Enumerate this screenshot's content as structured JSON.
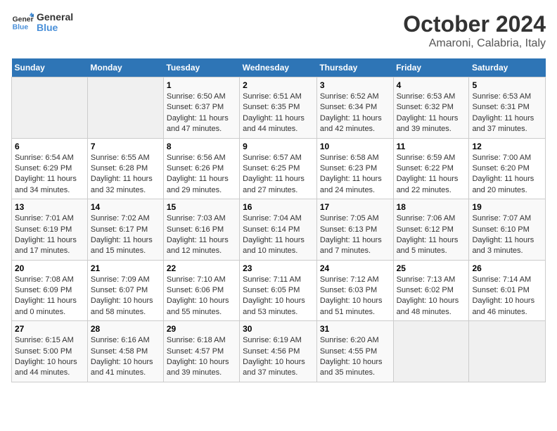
{
  "logo": {
    "text_general": "General",
    "text_blue": "Blue"
  },
  "title": "October 2024",
  "subtitle": "Amaroni, Calabria, Italy",
  "header_days": [
    "Sunday",
    "Monday",
    "Tuesday",
    "Wednesday",
    "Thursday",
    "Friday",
    "Saturday"
  ],
  "weeks": [
    [
      {
        "day": "",
        "info": ""
      },
      {
        "day": "",
        "info": ""
      },
      {
        "day": "1",
        "info": "Sunrise: 6:50 AM\nSunset: 6:37 PM\nDaylight: 11 hours and 47 minutes."
      },
      {
        "day": "2",
        "info": "Sunrise: 6:51 AM\nSunset: 6:35 PM\nDaylight: 11 hours and 44 minutes."
      },
      {
        "day": "3",
        "info": "Sunrise: 6:52 AM\nSunset: 6:34 PM\nDaylight: 11 hours and 42 minutes."
      },
      {
        "day": "4",
        "info": "Sunrise: 6:53 AM\nSunset: 6:32 PM\nDaylight: 11 hours and 39 minutes."
      },
      {
        "day": "5",
        "info": "Sunrise: 6:53 AM\nSunset: 6:31 PM\nDaylight: 11 hours and 37 minutes."
      }
    ],
    [
      {
        "day": "6",
        "info": "Sunrise: 6:54 AM\nSunset: 6:29 PM\nDaylight: 11 hours and 34 minutes."
      },
      {
        "day": "7",
        "info": "Sunrise: 6:55 AM\nSunset: 6:28 PM\nDaylight: 11 hours and 32 minutes."
      },
      {
        "day": "8",
        "info": "Sunrise: 6:56 AM\nSunset: 6:26 PM\nDaylight: 11 hours and 29 minutes."
      },
      {
        "day": "9",
        "info": "Sunrise: 6:57 AM\nSunset: 6:25 PM\nDaylight: 11 hours and 27 minutes."
      },
      {
        "day": "10",
        "info": "Sunrise: 6:58 AM\nSunset: 6:23 PM\nDaylight: 11 hours and 24 minutes."
      },
      {
        "day": "11",
        "info": "Sunrise: 6:59 AM\nSunset: 6:22 PM\nDaylight: 11 hours and 22 minutes."
      },
      {
        "day": "12",
        "info": "Sunrise: 7:00 AM\nSunset: 6:20 PM\nDaylight: 11 hours and 20 minutes."
      }
    ],
    [
      {
        "day": "13",
        "info": "Sunrise: 7:01 AM\nSunset: 6:19 PM\nDaylight: 11 hours and 17 minutes."
      },
      {
        "day": "14",
        "info": "Sunrise: 7:02 AM\nSunset: 6:17 PM\nDaylight: 11 hours and 15 minutes."
      },
      {
        "day": "15",
        "info": "Sunrise: 7:03 AM\nSunset: 6:16 PM\nDaylight: 11 hours and 12 minutes."
      },
      {
        "day": "16",
        "info": "Sunrise: 7:04 AM\nSunset: 6:14 PM\nDaylight: 11 hours and 10 minutes."
      },
      {
        "day": "17",
        "info": "Sunrise: 7:05 AM\nSunset: 6:13 PM\nDaylight: 11 hours and 7 minutes."
      },
      {
        "day": "18",
        "info": "Sunrise: 7:06 AM\nSunset: 6:12 PM\nDaylight: 11 hours and 5 minutes."
      },
      {
        "day": "19",
        "info": "Sunrise: 7:07 AM\nSunset: 6:10 PM\nDaylight: 11 hours and 3 minutes."
      }
    ],
    [
      {
        "day": "20",
        "info": "Sunrise: 7:08 AM\nSunset: 6:09 PM\nDaylight: 11 hours and 0 minutes."
      },
      {
        "day": "21",
        "info": "Sunrise: 7:09 AM\nSunset: 6:07 PM\nDaylight: 10 hours and 58 minutes."
      },
      {
        "day": "22",
        "info": "Sunrise: 7:10 AM\nSunset: 6:06 PM\nDaylight: 10 hours and 55 minutes."
      },
      {
        "day": "23",
        "info": "Sunrise: 7:11 AM\nSunset: 6:05 PM\nDaylight: 10 hours and 53 minutes."
      },
      {
        "day": "24",
        "info": "Sunrise: 7:12 AM\nSunset: 6:03 PM\nDaylight: 10 hours and 51 minutes."
      },
      {
        "day": "25",
        "info": "Sunrise: 7:13 AM\nSunset: 6:02 PM\nDaylight: 10 hours and 48 minutes."
      },
      {
        "day": "26",
        "info": "Sunrise: 7:14 AM\nSunset: 6:01 PM\nDaylight: 10 hours and 46 minutes."
      }
    ],
    [
      {
        "day": "27",
        "info": "Sunrise: 6:15 AM\nSunset: 5:00 PM\nDaylight: 10 hours and 44 minutes."
      },
      {
        "day": "28",
        "info": "Sunrise: 6:16 AM\nSunset: 4:58 PM\nDaylight: 10 hours and 41 minutes."
      },
      {
        "day": "29",
        "info": "Sunrise: 6:18 AM\nSunset: 4:57 PM\nDaylight: 10 hours and 39 minutes."
      },
      {
        "day": "30",
        "info": "Sunrise: 6:19 AM\nSunset: 4:56 PM\nDaylight: 10 hours and 37 minutes."
      },
      {
        "day": "31",
        "info": "Sunrise: 6:20 AM\nSunset: 4:55 PM\nDaylight: 10 hours and 35 minutes."
      },
      {
        "day": "",
        "info": ""
      },
      {
        "day": "",
        "info": ""
      }
    ]
  ]
}
